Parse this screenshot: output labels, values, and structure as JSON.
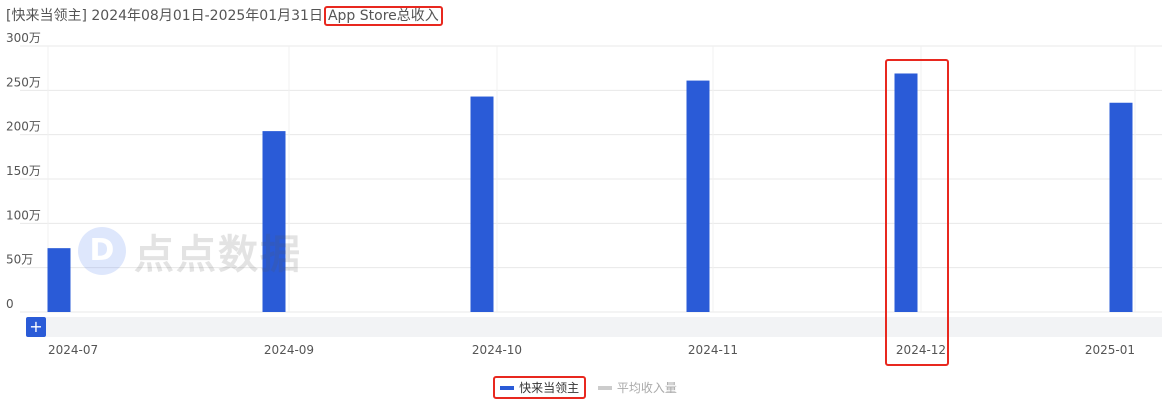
{
  "header": {
    "prefix": "[快来当领主] 2024年08月01日-2025年01月31日",
    "metric": "App Store总收入"
  },
  "colors": {
    "bar": "#2a5bd7",
    "grid": "#e8e8e8",
    "highlight": "#e8281f",
    "inactive": "#cccccc"
  },
  "watermark": {
    "text": "点点数据"
  },
  "toolbar": {
    "plus_label": "+"
  },
  "legend": [
    {
      "name": "快来当领主",
      "active": true,
      "color": "#2a5bd7"
    },
    {
      "name": "平均收入量",
      "active": false,
      "color": "#cccccc"
    }
  ],
  "chart_data": {
    "type": "bar",
    "categories": [
      "2024-07",
      "2024-09",
      "2024-10",
      "2024-11",
      "2024-12",
      "2025-01"
    ],
    "series": [
      {
        "name": "快来当领主",
        "values": [
          720000,
          2040000,
          2430000,
          2610000,
          2690000,
          2360000
        ]
      }
    ],
    "yticks": [
      "0",
      "50万",
      "100万",
      "150万",
      "200万",
      "250万",
      "300万"
    ],
    "ylim": [
      0,
      3000000
    ],
    "grid": true,
    "legend": "bottom-center",
    "highlighted_category": "2024-12"
  }
}
